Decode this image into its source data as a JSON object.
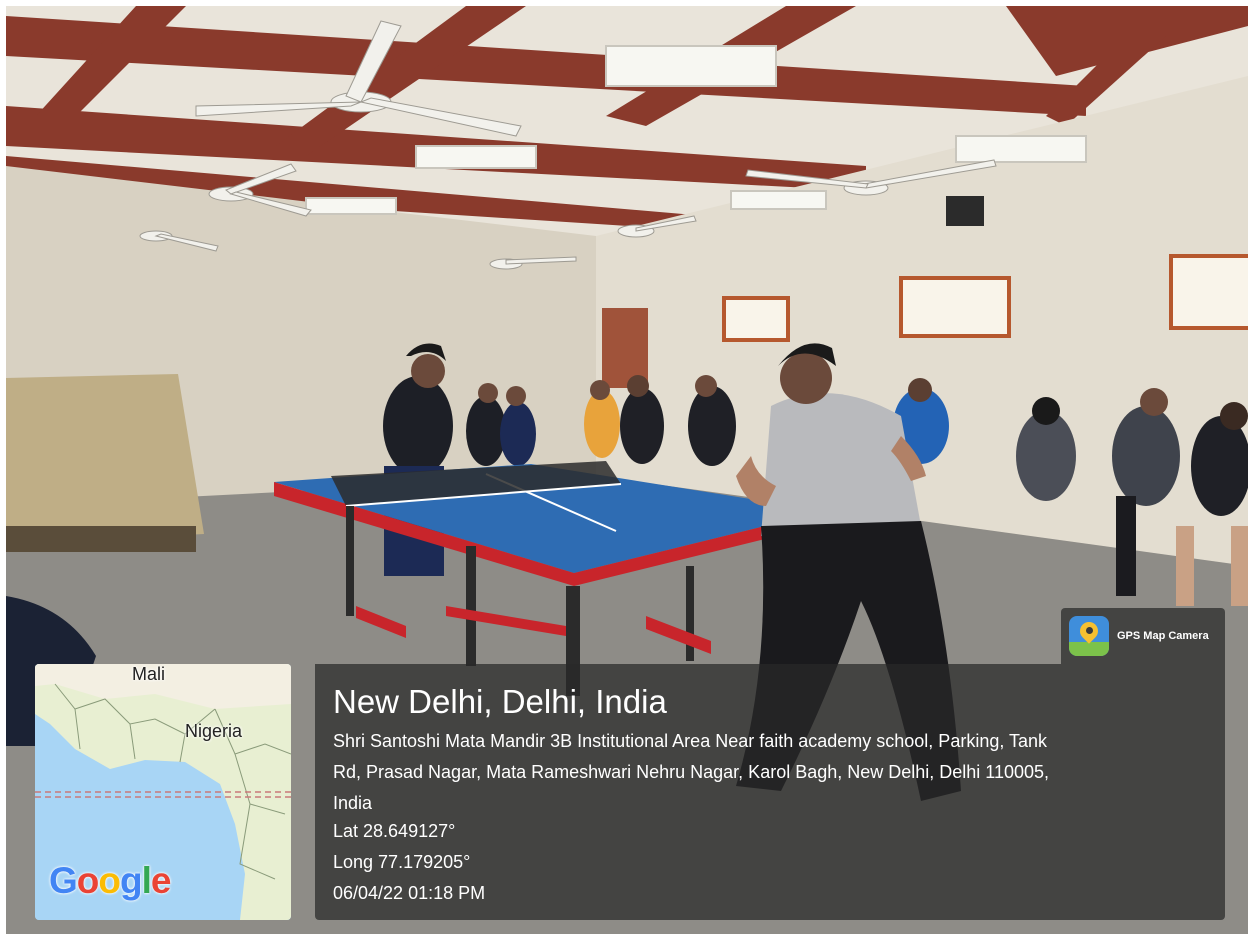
{
  "overlay": {
    "app_badge": {
      "label": "GPS Map Camera",
      "icon": "gps-map-camera-icon"
    },
    "location": {
      "city": "New Delhi, Delhi, India",
      "address_lines": [
        "Shri Santoshi Mata Mandir 3B Institutional Area Near faith academy school, Parking, Tank",
        "Rd, Prasad Nagar, Mata Rameshwari Nehru Nagar, Karol Bagh, New Delhi, Delhi 110005,",
        "India"
      ],
      "lat": "Lat 28.649127°",
      "long": "Long 77.179205°",
      "datetime": "06/04/22 01:18 PM"
    },
    "map": {
      "labels": [
        "Mali",
        "Nigeria"
      ],
      "logo": "Google",
      "colors": {
        "water": "#a8d5f5",
        "land": "#e8efd2",
        "logo_blue": "#4285f4",
        "logo_red": "#ea4335",
        "logo_yellow": "#fbbc05",
        "logo_green": "#34a853"
      }
    }
  }
}
